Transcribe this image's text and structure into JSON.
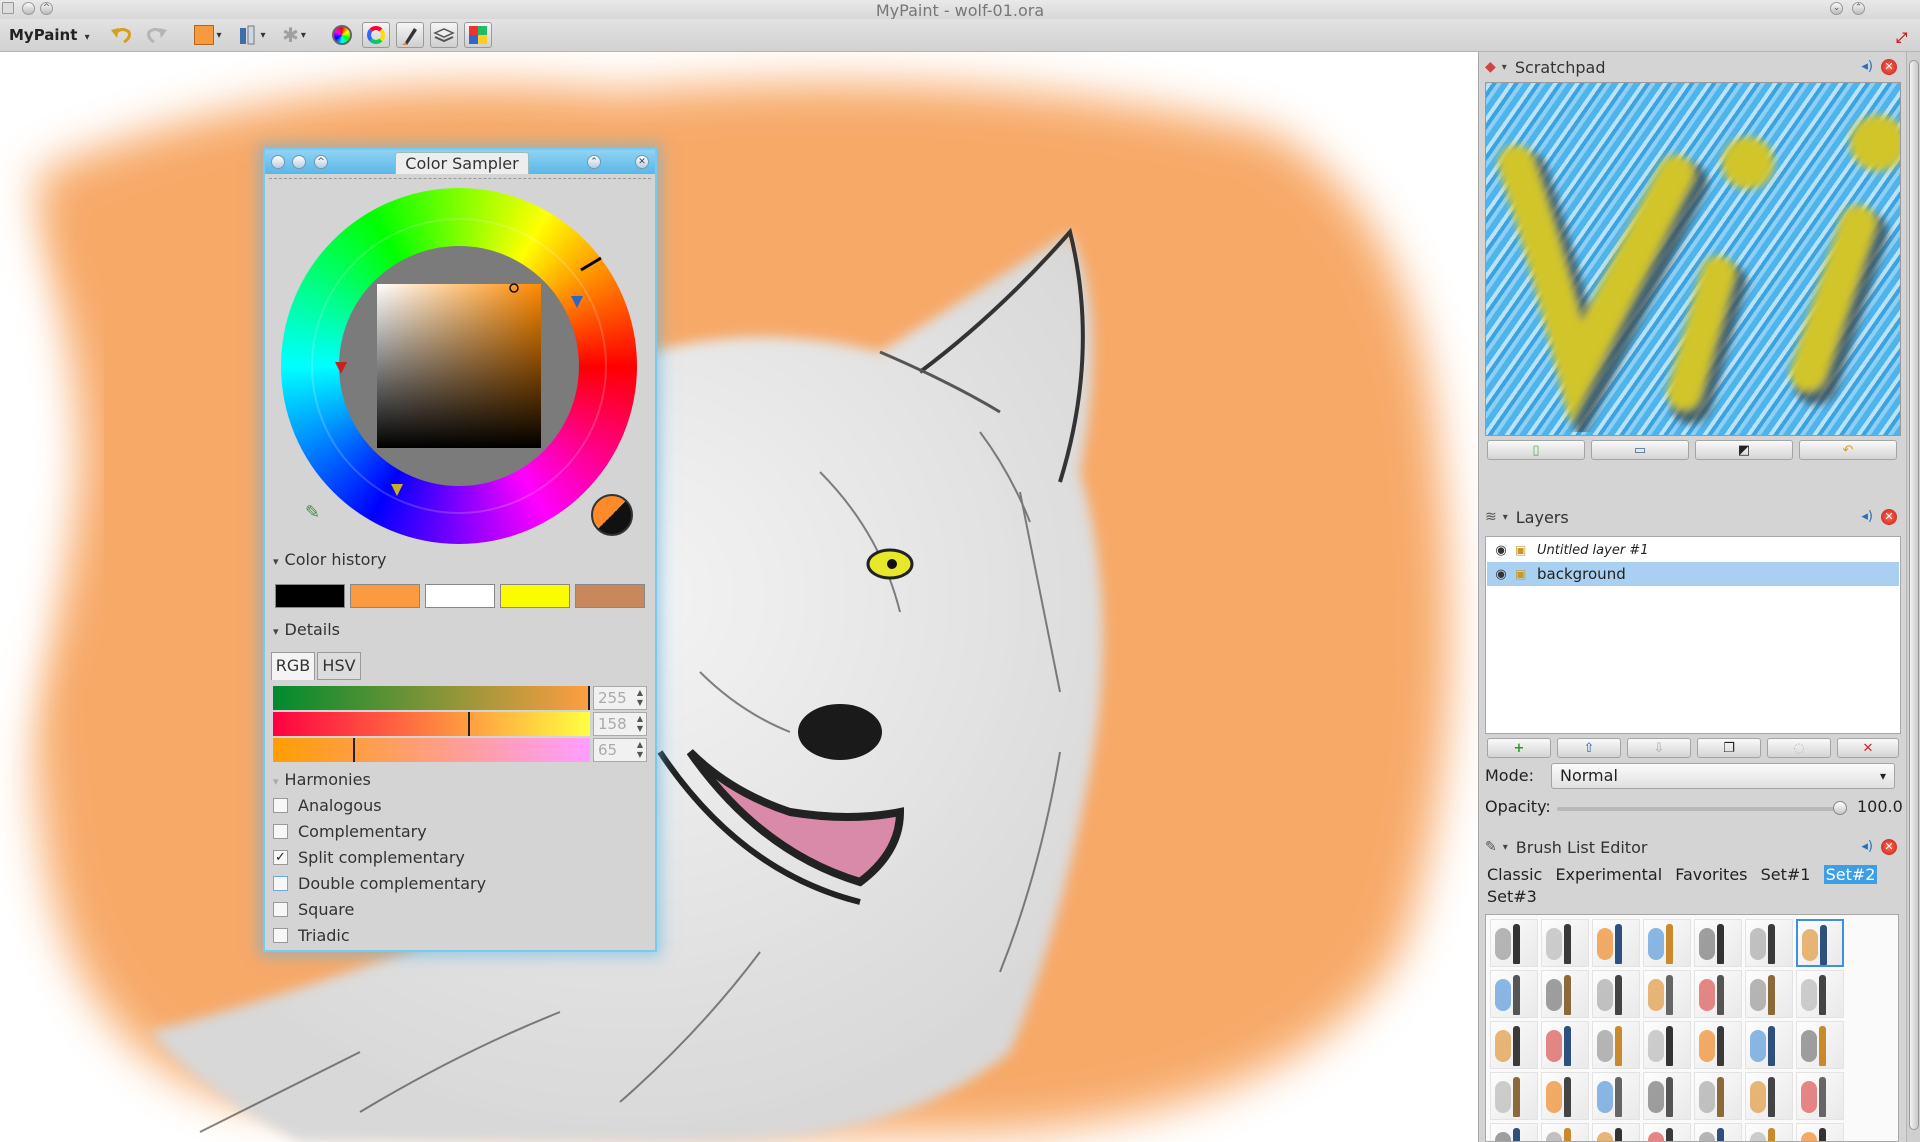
{
  "window": {
    "title": "MyPaint - wolf-01.ora",
    "min_glyph": "⌄",
    "max_glyph": "⌃"
  },
  "toolbar": {
    "app_menu": "MyPaint",
    "current_color": "#f7993f"
  },
  "color_sampler": {
    "title": "Color Sampler",
    "close_glyph": "✕",
    "color_history": {
      "heading": "Color history",
      "swatches": [
        "#000000",
        "#fb9a3f",
        "#ffffff",
        "#fcfc00",
        "#c9875c"
      ]
    },
    "details": {
      "heading": "Details",
      "tabs": [
        "RGB",
        "HSV"
      ],
      "active_tab": "RGB",
      "sliders": [
        {
          "channel": "R",
          "value": "255",
          "level": 1.0
        },
        {
          "channel": "G",
          "value": "158",
          "level": 0.62
        },
        {
          "channel": "B",
          "value": "65",
          "level": 0.255
        }
      ]
    },
    "harmonies": {
      "heading": "Harmonies",
      "items": [
        {
          "label": "Analogous",
          "checked": false
        },
        {
          "label": "Complementary",
          "checked": false
        },
        {
          "label": "Split complementary",
          "checked": true
        },
        {
          "label": "Double complementary",
          "checked": false
        },
        {
          "label": "Square",
          "checked": false
        },
        {
          "label": "Triadic",
          "checked": false
        }
      ]
    },
    "check_glyph": "✓"
  },
  "scratchpad": {
    "title": "Scratchpad"
  },
  "layers": {
    "title": "Layers",
    "rows": [
      {
        "name": "Untitled layer #1",
        "italic": true,
        "selected": false
      },
      {
        "name": "background",
        "italic": false,
        "selected": true
      }
    ],
    "mode_label": "Mode:",
    "mode_value": "Normal",
    "opacity_label": "Opacity:",
    "opacity_value": "100.0",
    "opacity_level": 1.0
  },
  "brush_list": {
    "title": "Brush List Editor",
    "groups": [
      "Classic",
      "Experimental",
      "Favorites",
      "Set#1",
      "Set#2",
      "Set#3"
    ],
    "selected_group": "Set#2"
  },
  "colors": {
    "accent": "#3d9ee8",
    "canvas_orange": "#f7a560",
    "sampler_glow": "#56b4e9"
  }
}
